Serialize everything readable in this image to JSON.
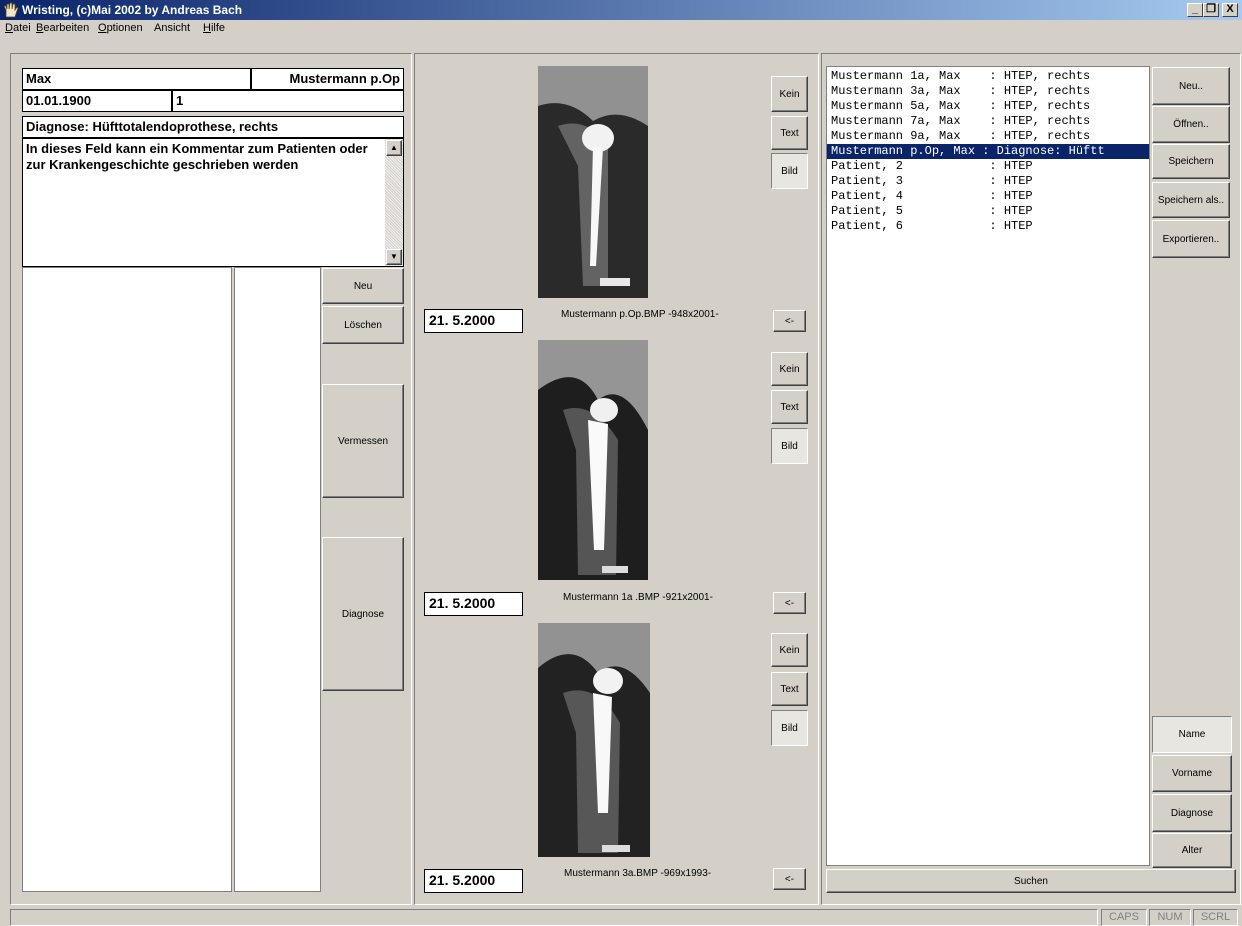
{
  "window": {
    "title": "Wristing, (c)Mai 2002 by Andreas Bach",
    "minimize": "_",
    "maximize": "❐",
    "close": "X"
  },
  "menu": [
    "Datei",
    "Bearbeiten",
    "Optionen",
    "Ansicht",
    "Hilfe"
  ],
  "patient": {
    "first_name": "Max",
    "last_name": "Mustermann p.Op",
    "birthdate": "01.01.1900",
    "number": "1",
    "diagnosis": "Diagnose: Hüfttotalendoprothese, rechts",
    "comment": "In dieses Feld kann ein Kommentar zum Patienten oder zur Krankengeschichte geschrieben werden"
  },
  "left_buttons": {
    "neu": "Neu",
    "loeschen": "Löschen",
    "vermessen": "Vermessen",
    "diagnose": "Diagnose"
  },
  "images": [
    {
      "date": "21. 5.2000",
      "caption": "Mustermann p.Op.BMP -948x2001-",
      "kein": "Kein",
      "text": "Text",
      "bild": "Bild",
      "back": "<-"
    },
    {
      "date": "21. 5.2000",
      "caption": "Mustermann 1a .BMP -921x2001-",
      "kein": "Kein",
      "text": "Text",
      "bild": "Bild",
      "back": "<-"
    },
    {
      "date": "21. 5.2000",
      "caption": "Mustermann 3a.BMP -969x1993-",
      "kein": "Kein",
      "text": "Text",
      "bild": "Bild",
      "back": "<-"
    }
  ],
  "patient_list": [
    "Mustermann 1a, Max    : HTEP, rechts",
    "Mustermann 3a, Max    : HTEP, rechts",
    "Mustermann 5a, Max    : HTEP, rechts",
    "Mustermann 7a, Max    : HTEP, rechts",
    "Mustermann 9a, Max    : HTEP, rechts",
    "Mustermann p.Op, Max : Diagnose: Hüftt",
    "Patient, 2            : HTEP",
    "Patient, 3            : HTEP",
    "Patient, 4            : HTEP",
    "Patient, 5            : HTEP",
    "Patient, 6            : HTEP"
  ],
  "selected_index": 5,
  "right_buttons": {
    "neu": "Neu..",
    "oeffnen": "Öffnen..",
    "speichern": "Speichern",
    "speichern_als": "Speichern als..",
    "exportieren": "Exportieren.."
  },
  "sort_buttons": {
    "name": "Name",
    "vorname": "Vorname",
    "diagnose": "Diagnose",
    "alter": "Alter"
  },
  "search_label": "Suchen",
  "status": {
    "caps": "CAPS",
    "num": "NUM",
    "scrl": "SCRL"
  }
}
